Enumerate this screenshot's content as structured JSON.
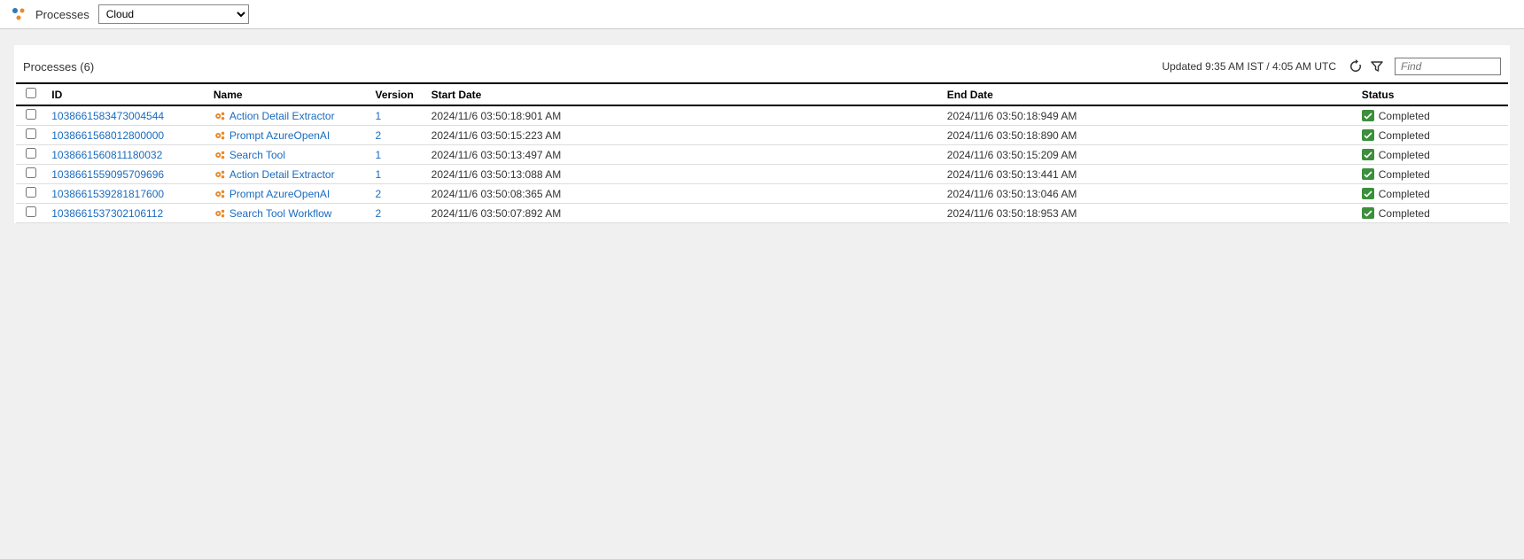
{
  "topbar": {
    "app_label": "Processes",
    "env_selected": "Cloud"
  },
  "panel": {
    "title": "Processes (6)",
    "updated_text": "Updated 9:35 AM IST / 4:05 AM UTC",
    "find_placeholder": "Find"
  },
  "columns": {
    "id": "ID",
    "name": "Name",
    "version": "Version",
    "start": "Start Date",
    "end": "End Date",
    "status": "Status"
  },
  "status_label": "Completed",
  "rows": [
    {
      "id": "1038661583473004544",
      "name": "Action Detail Extractor",
      "version": "1",
      "start": "2024/11/6 03:50:18:901 AM",
      "end": "2024/11/6 03:50:18:949 AM"
    },
    {
      "id": "1038661568012800000",
      "name": "Prompt AzureOpenAI",
      "version": "2",
      "start": "2024/11/6 03:50:15:223 AM",
      "end": "2024/11/6 03:50:18:890 AM"
    },
    {
      "id": "1038661560811180032",
      "name": "Search Tool",
      "version": "1",
      "start": "2024/11/6 03:50:13:497 AM",
      "end": "2024/11/6 03:50:15:209 AM"
    },
    {
      "id": "1038661559095709696",
      "name": "Action Detail Extractor",
      "version": "1",
      "start": "2024/11/6 03:50:13:088 AM",
      "end": "2024/11/6 03:50:13:441 AM"
    },
    {
      "id": "1038661539281817600",
      "name": "Prompt AzureOpenAI",
      "version": "2",
      "start": "2024/11/6 03:50:08:365 AM",
      "end": "2024/11/6 03:50:13:046 AM"
    },
    {
      "id": "1038661537302106112",
      "name": "Search Tool Workflow",
      "version": "2",
      "start": "2024/11/6 03:50:07:892 AM",
      "end": "2024/11/6 03:50:18:953 AM"
    }
  ]
}
